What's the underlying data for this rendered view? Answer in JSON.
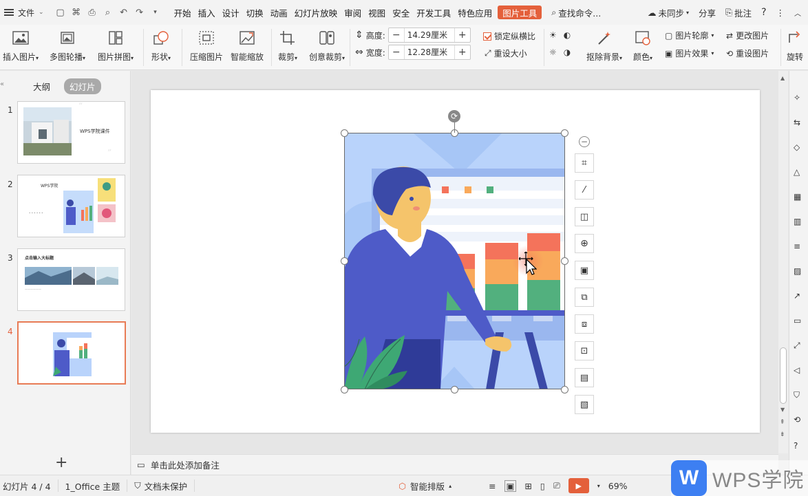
{
  "menubar": {
    "file_label": "文件",
    "tabs": [
      "开始",
      "插入",
      "设计",
      "切换",
      "动画",
      "幻灯片放映",
      "审阅",
      "视图",
      "安全",
      "开发工具",
      "特色应用"
    ],
    "active_tab": "图片工具",
    "search_label": "查找命令...",
    "sync_label": "未同步",
    "share_label": "分享",
    "comment_label": "批注"
  },
  "ribbon": {
    "insert_picture": "插入图片",
    "multi_carousel": "多图轮播",
    "picture_collage": "图片拼图",
    "shape": "形状",
    "compress_picture": "压缩图片",
    "smart_scale": "智能缩放",
    "crop": "裁剪",
    "creative_crop": "创意裁剪",
    "height_label": "高度:",
    "height_value": "14.29厘米",
    "width_label": "宽度:",
    "width_value": "12.28厘米",
    "lock_ratio": "锁定纵横比",
    "reset_size": "重设大小",
    "remove_bg": "抠除背景",
    "color": "颜色",
    "picture_outline": "图片轮廓",
    "picture_effect": "图片效果",
    "change_picture": "更改图片",
    "reset_picture": "重设图片",
    "rotate": "旋转"
  },
  "left_panel": {
    "tab_outline": "大纲",
    "tab_slides": "幻灯片",
    "slides": [
      {
        "num": "1",
        "title": "WPS学院课件"
      },
      {
        "num": "2",
        "title": "WPS学院"
      },
      {
        "num": "3",
        "title": "点击输入大标题"
      },
      {
        "num": "4",
        "title": ""
      }
    ]
  },
  "notes_placeholder": "单击此处添加备注",
  "status": {
    "slide_counter": "幻灯片 4 / 4",
    "theme": "1_Office 主题",
    "protection": "文档未保护",
    "smart_layout": "智能排版",
    "zoom": "69%"
  },
  "watermark": "WPS学院",
  "colors": {
    "accent": "#e4603b",
    "illustration_bg": "#b9d3fb",
    "person_sweater": "#4e5bc8",
    "person_skin": "#f5c46b",
    "bar_red": "#f4735b",
    "bar_orange": "#f9a95b",
    "bar_green": "#52b07e",
    "plant_green": "#3ea874"
  }
}
